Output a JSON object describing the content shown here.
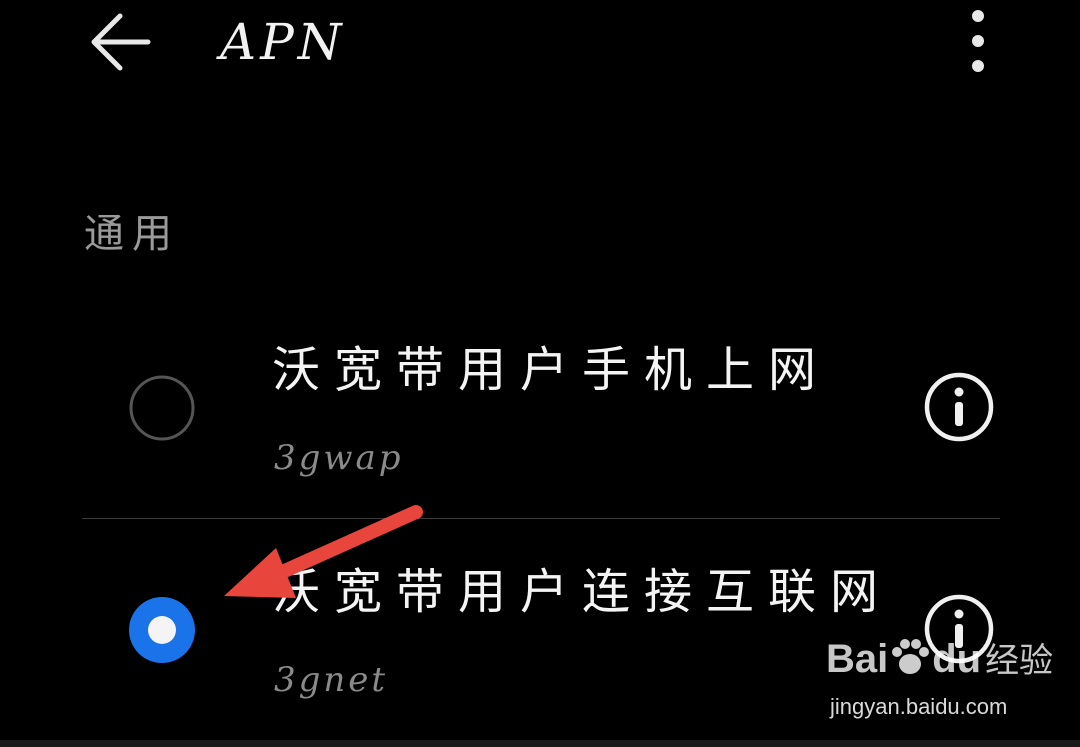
{
  "header": {
    "title": "APN",
    "back_icon": "arrow-left-icon",
    "more_icon": "more-vertical-icon"
  },
  "section": {
    "label": "通用"
  },
  "apns": [
    {
      "name": "沃宽带用户手机上网",
      "apn": "3gwap",
      "selected": false
    },
    {
      "name": "沃宽带用户连接互联网",
      "apn": "3gnet",
      "selected": true
    }
  ],
  "annotation": {
    "arrow_color": "#e8463c"
  },
  "watermark": {
    "logo_text_a": "Bai",
    "logo_text_b": "du",
    "logo_text_c": "经验",
    "url": "jingyan.baidu.com"
  },
  "colors": {
    "accent": "#1a73e8",
    "background": "#000000",
    "radio_off": "#555555"
  }
}
